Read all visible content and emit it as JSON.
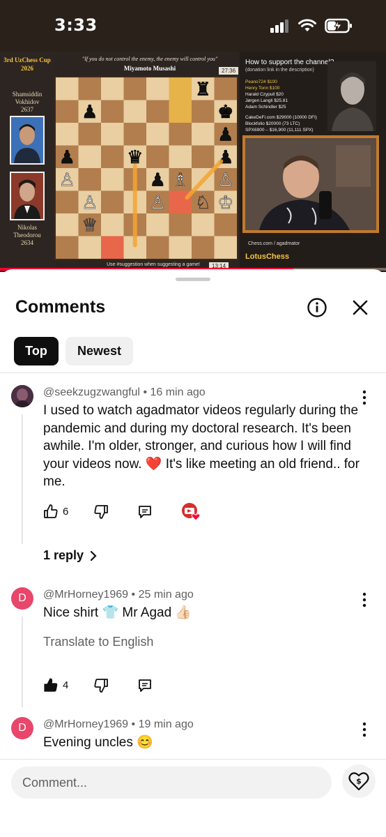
{
  "status_bar": {
    "time": "3:33",
    "battery_percent": 40
  },
  "video": {
    "event_title": "3rd UzChess Cup 2026",
    "quote": "\"If you do not control the enemy, the enemy will control you\"",
    "quote_author": "Miyamoto Musashi",
    "top_clock": "27:36",
    "bottom_clock": "13:14",
    "player_top": {
      "first": "Shamsiddin",
      "last": "Vokhidov",
      "rating": "2637"
    },
    "player_bottom": {
      "first": "Nikolas",
      "last": "Theodorou",
      "rating": "2634"
    },
    "board_caption": "Use #suggestion when suggesting a game!",
    "support_title": "How to support the channel?",
    "support_sub": "(donation link in the description)",
    "donors_top": [
      "Peano724 $100",
      "Henry Tonn $100",
      "Harald Czypull $20",
      "Jørgen Langli $25.81",
      "Adam Schindler $25"
    ],
    "donors_bottom": [
      "CakeDeFi.com $29000 (10000 DFI)",
      "Blockfolio $20000 (73 LTC)",
      "SPX6900 – $16,900 (11,111 SPX)"
    ],
    "social": "Chess.com / agadmator",
    "brand": "LotusChess",
    "progress": 0.76
  },
  "sheet": {
    "title": "Comments",
    "tabs": [
      {
        "label": "Top",
        "active": true
      },
      {
        "label": "Newest",
        "active": false
      }
    ]
  },
  "comments": [
    {
      "author": "@seekzugzwangful",
      "time": "16 min ago",
      "text": "I used to watch agadmator videos regularly during the pandemic and during my doctoral research. It's been awhile. I'm older, stronger, and curious how I will find your videos now. ❤️ It's like meeting an old friend.. for me.",
      "likes": "6",
      "replies": "1 reply"
    },
    {
      "author": "@MrHorney1969",
      "time": "25 min ago",
      "text": "Nice shirt 👕 Mr Agad 👍🏻",
      "translate": "Translate to English",
      "likes": "4",
      "avatar_letter": "D",
      "avatar_color": "#e8466b"
    },
    {
      "author": "@MrHorney1969",
      "time": "19 min ago",
      "text": "Evening uncles 😊",
      "avatar_letter": "D",
      "avatar_color": "#e8466b"
    }
  ],
  "composer": {
    "placeholder": "Comment..."
  },
  "colors": {
    "accent": "#ff0033",
    "text": "#0f0f0f",
    "muted": "#606060"
  }
}
